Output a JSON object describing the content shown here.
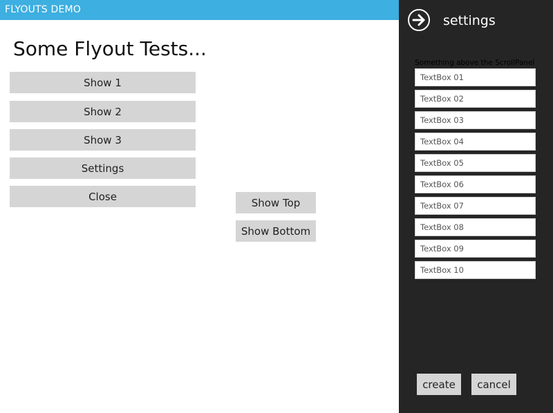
{
  "app": {
    "title": "FLYOUTS DEMO"
  },
  "main": {
    "heading": "Some Flyout Tests...",
    "left_buttons": [
      "Show 1",
      "Show 2",
      "Show 3",
      "Settings",
      "Close"
    ],
    "middle_buttons": [
      "Show Top",
      "Show Bottom"
    ]
  },
  "flyout": {
    "title": "settings",
    "back_icon": "arrow-right-circle-icon",
    "caption": "Something above the ScrollPanel",
    "textboxes": [
      "TextBox 01",
      "TextBox 02",
      "TextBox 03",
      "TextBox 04",
      "TextBox 05",
      "TextBox 06",
      "TextBox 07",
      "TextBox 08",
      "TextBox 09",
      "TextBox 10"
    ],
    "create_label": "create",
    "cancel_label": "cancel"
  },
  "colors": {
    "titlebar": "#3dafe0",
    "flyout_background": "#252525",
    "button_background": "#d5d5d5"
  }
}
